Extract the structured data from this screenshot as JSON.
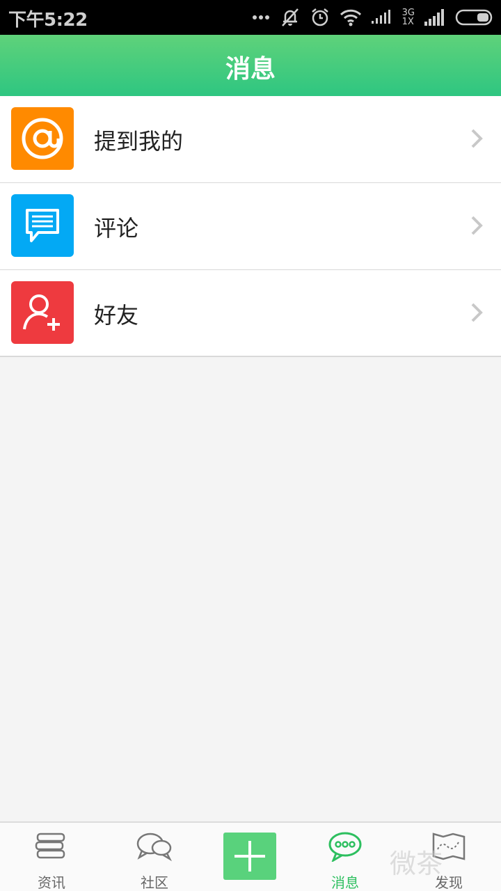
{
  "status_bar": {
    "time": "下午5:22",
    "network_top": "3G",
    "network_bottom": "1X"
  },
  "header": {
    "title": "消息"
  },
  "messages": {
    "items": [
      {
        "label": "提到我的",
        "icon": "at-icon",
        "color": "#ff8a00"
      },
      {
        "label": "评论",
        "icon": "comment-icon",
        "color": "#03a9f4"
      },
      {
        "label": "好友",
        "icon": "add-friend-icon",
        "color": "#ee3a3f"
      }
    ]
  },
  "tabbar": {
    "tabs": [
      {
        "label": "资讯",
        "icon": "news-icon",
        "active": false
      },
      {
        "label": "社区",
        "icon": "community-icon",
        "active": false
      },
      {
        "label": "",
        "icon": "plus-icon",
        "active": false
      },
      {
        "label": "消息",
        "icon": "message-icon",
        "active": true
      },
      {
        "label": "发现",
        "icon": "discover-icon",
        "active": false
      }
    ],
    "accent": "#2dbf5f"
  },
  "watermark": "微茶"
}
